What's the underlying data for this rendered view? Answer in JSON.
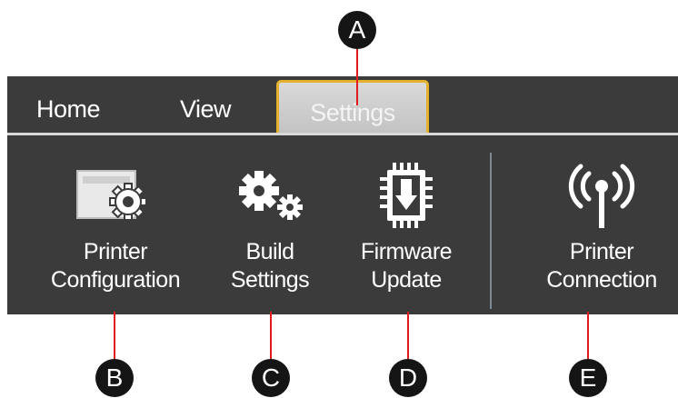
{
  "tabs": {
    "home": "Home",
    "view": "View",
    "settings": "Settings"
  },
  "commands": {
    "printer_configuration": {
      "line1": "Printer",
      "line2": "Configuration",
      "icon": "printer-gear-icon"
    },
    "build_settings": {
      "line1": "Build",
      "line2": "Settings",
      "icon": "gears-icon"
    },
    "firmware_update": {
      "line1": "Firmware",
      "line2": "Update",
      "icon": "chip-download-icon"
    },
    "printer_connection": {
      "line1": "Printer",
      "line2": "Connection",
      "icon": "antenna-icon"
    }
  },
  "callouts": {
    "a": "A",
    "b": "B",
    "c": "C",
    "d": "D",
    "e": "E"
  },
  "colors": {
    "ribbon_bg": "#3b3b3b",
    "active_tab_border": "#e3b12c",
    "leader_line": "#e01b1b",
    "callout_bg": "#151515"
  }
}
